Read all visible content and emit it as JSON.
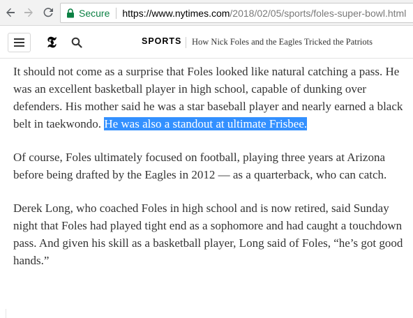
{
  "browser": {
    "secure_label": "Secure",
    "url_host": "https://www.nytimes.com",
    "url_path": "/2018/02/05/sports/foles-super-bowl.html",
    "secure_color": "#0b8043"
  },
  "header": {
    "logo_glyph": "𝕿",
    "section": "SPORTS",
    "headline": "How Nick Foles and the Eagles Tricked the Patriots"
  },
  "article": {
    "p1_before": "It should not come as a surprise that Foles looked like natural catching a pass. He was an excellent basketball player in high school, capable of dunking over defenders. His mother said he was a star baseball player and nearly earned a black belt in taekwondo. ",
    "p1_selected": "He was also a standout at ultimate Frisbee.",
    "p2": "Of course, Foles ultimately focused on football, playing three years at Arizona before being drafted by the Eagles in 2012 — as a quarterback, who can catch.",
    "p3": "Derek Long, who coached Foles in high school and is now retired, said Sunday night that Foles had played tight end as a sophomore and had caught a touchdown pass. And given his skill as a basketball player, Long said of Foles, “he’s got good hands.”"
  },
  "colors": {
    "selection": "#3390ff",
    "body_text": "#333333"
  },
  "icons": {
    "back": "arrow-left-icon",
    "forward": "arrow-right-icon",
    "reload": "reload-icon",
    "lock": "lock-icon",
    "menu": "hamburger-menu-icon",
    "search": "search-icon"
  }
}
